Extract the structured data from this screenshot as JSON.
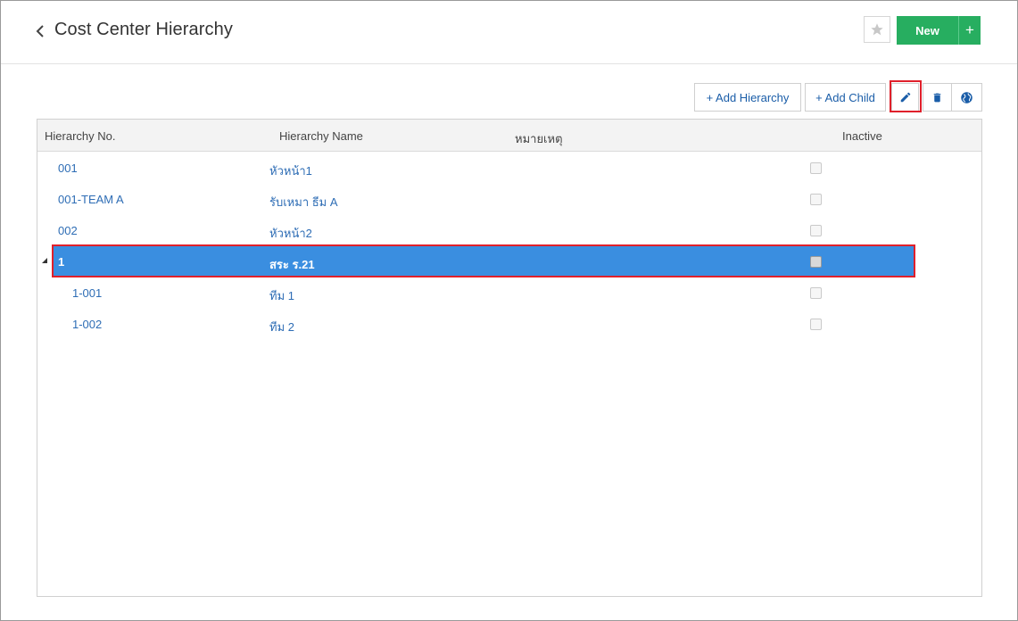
{
  "header": {
    "title": "Cost Center Hierarchy",
    "new_label": "New",
    "new_plus_label": "+"
  },
  "toolbar": {
    "add_hierarchy_label": "+ Add Hierarchy",
    "add_child_label": "+ Add Child"
  },
  "colors": {
    "accent": "#27ae60",
    "link": "#2e6db5",
    "selected_row": "#3a8ee0",
    "highlight": "#e0202b"
  },
  "icons": {
    "back": "chevron-left-icon",
    "favorite": "star-icon",
    "edit": "pencil-icon",
    "delete": "trash-icon",
    "language": "globe-icon",
    "expand": "triangle-expand-icon"
  },
  "grid": {
    "columns": [
      "Hierarchy No.",
      "Hierarchy Name",
      "หมายเหตุ",
      "Inactive"
    ],
    "rows": [
      {
        "no": "001",
        "name": "หัวหน้า1",
        "note": "",
        "inactive": false,
        "level": 0,
        "selected": false
      },
      {
        "no": "001-TEAM A",
        "name": "รับเหมา ธีม A",
        "note": "",
        "inactive": false,
        "level": 0,
        "selected": false
      },
      {
        "no": "002",
        "name": "หัวหน้า2",
        "note": "",
        "inactive": false,
        "level": 0,
        "selected": false
      },
      {
        "no": "1",
        "name": "สระ ร.21",
        "note": "",
        "inactive": false,
        "level": 0,
        "selected": true,
        "expanded": true
      },
      {
        "no": "1-001",
        "name": "ทีม 1",
        "note": "",
        "inactive": false,
        "level": 1,
        "selected": false
      },
      {
        "no": "1-002",
        "name": "ทีม 2",
        "note": "",
        "inactive": false,
        "level": 1,
        "selected": false
      }
    ]
  }
}
